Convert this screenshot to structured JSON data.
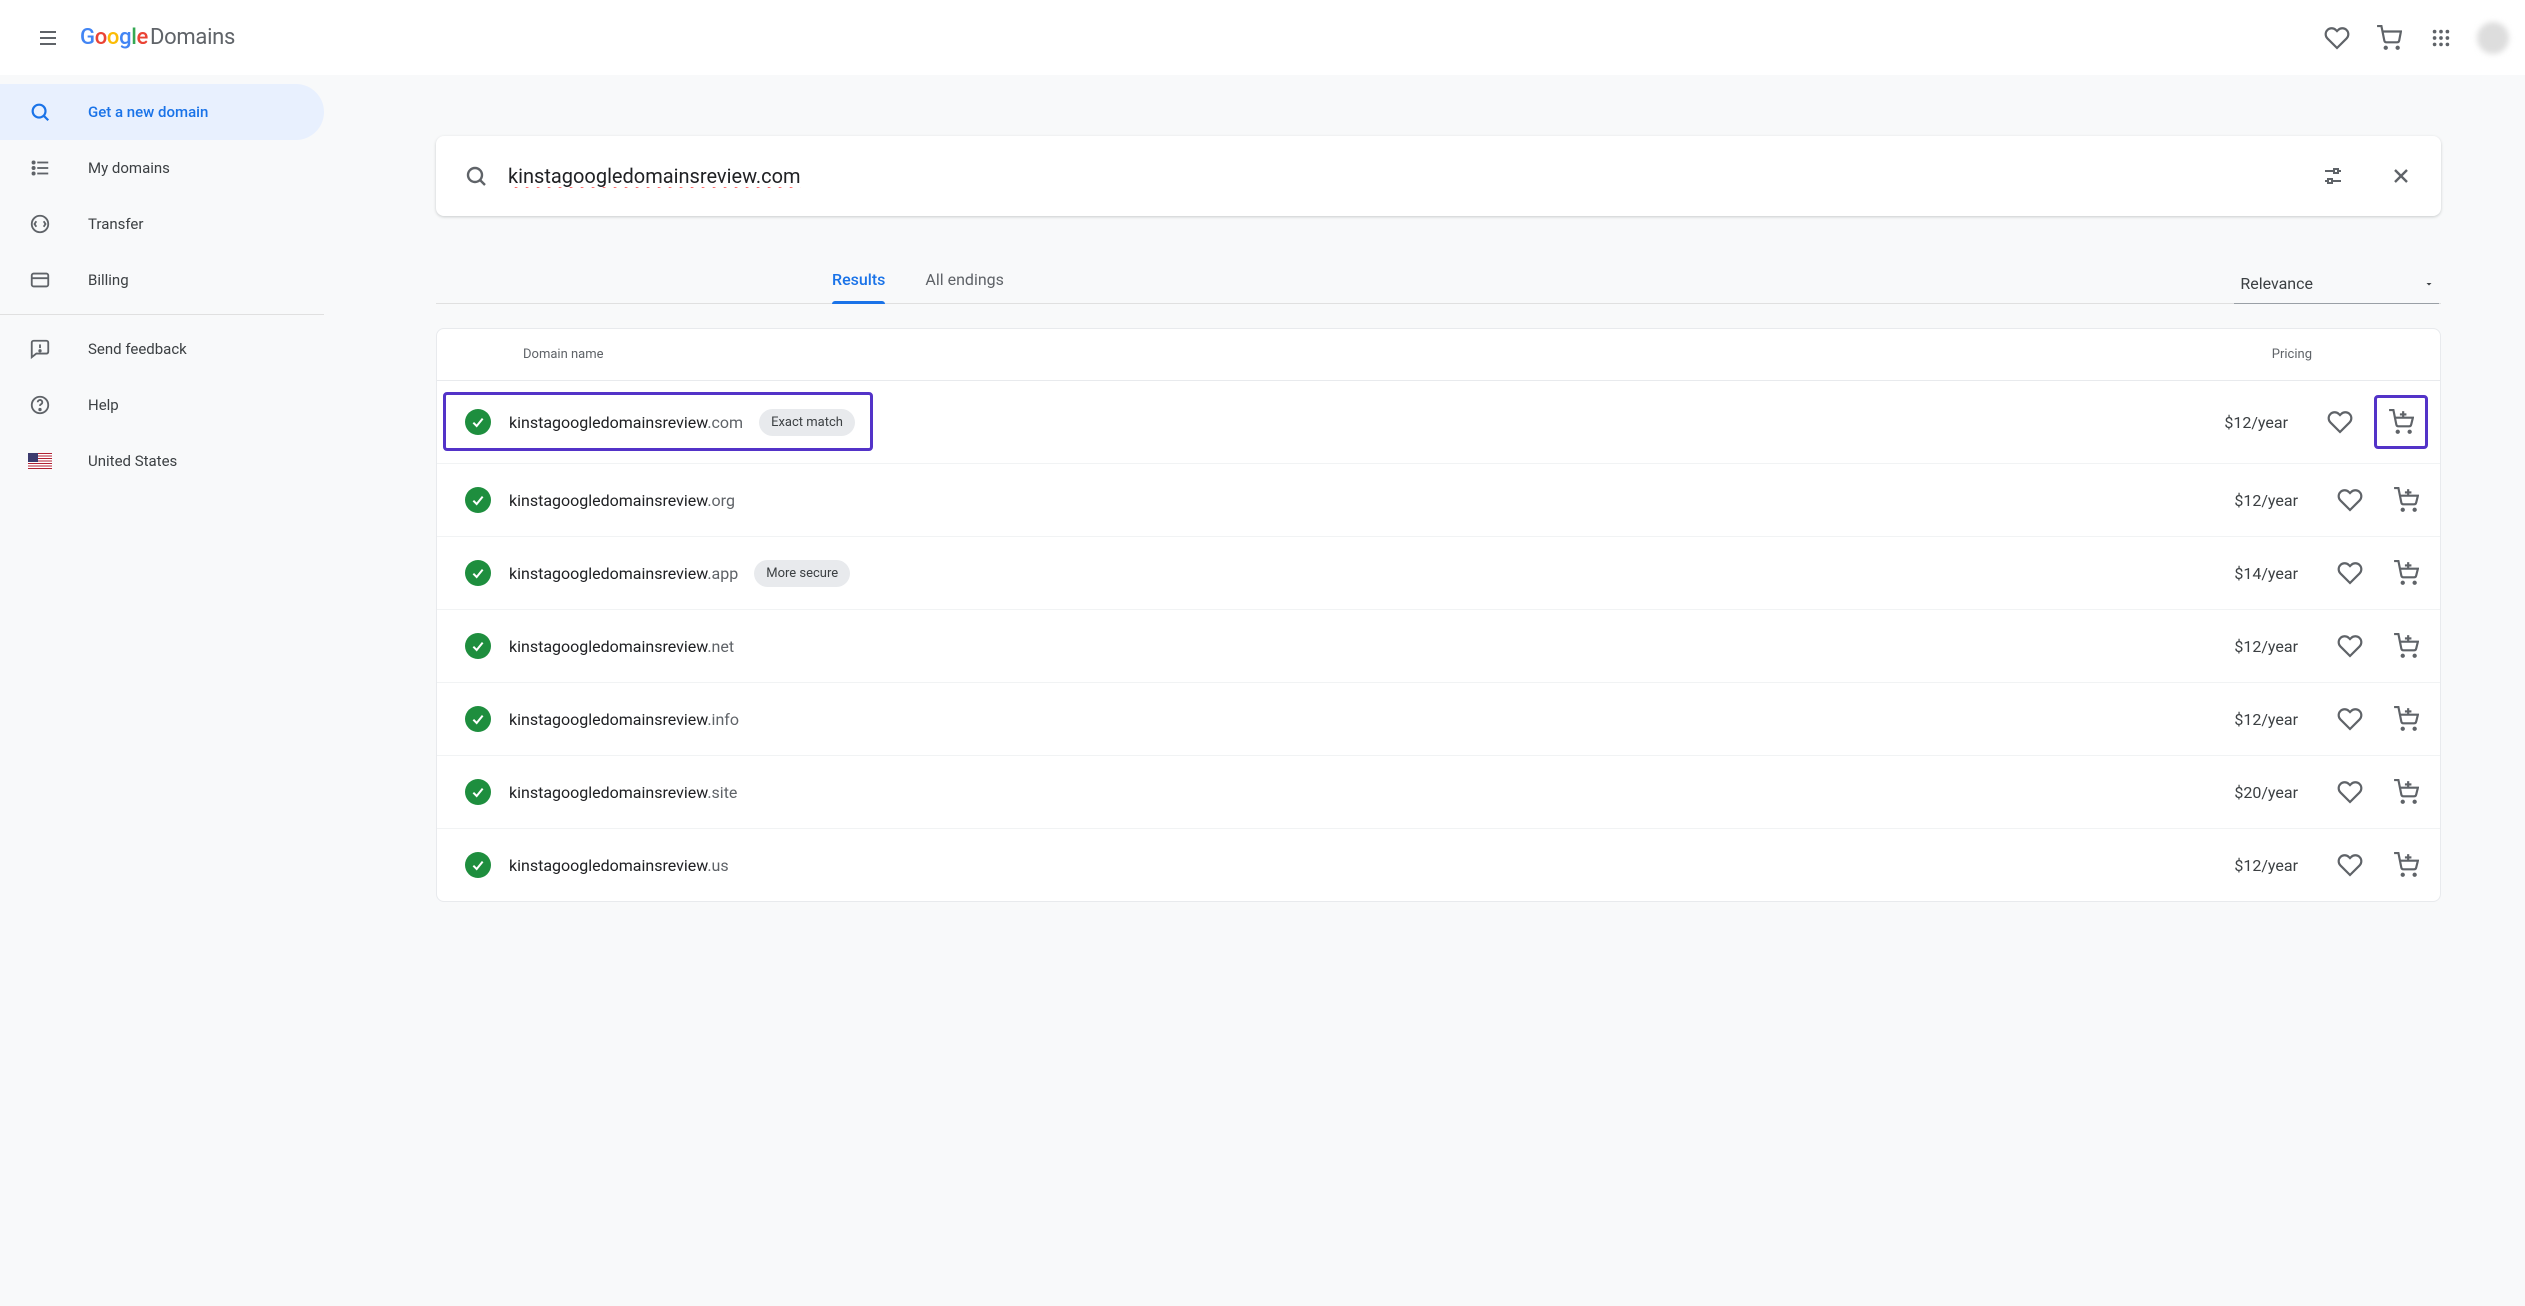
{
  "brand": {
    "product": "Domains"
  },
  "header_icons": {
    "favorites_alt": "Favorites",
    "cart_alt": "Cart",
    "apps_alt": "Google apps"
  },
  "sidebar": {
    "items": [
      {
        "id": "get-new",
        "label": "Get a new domain"
      },
      {
        "id": "my",
        "label": "My domains"
      },
      {
        "id": "transfer",
        "label": "Transfer"
      },
      {
        "id": "billing",
        "label": "Billing"
      }
    ],
    "footer_items": [
      {
        "id": "feedback",
        "label": "Send feedback"
      },
      {
        "id": "help",
        "label": "Help"
      },
      {
        "id": "region",
        "label": "United States"
      }
    ]
  },
  "search": {
    "value": "kinstagoogledomainsreview.com"
  },
  "tabs": {
    "results": "Results",
    "endings": "All endings"
  },
  "sort": {
    "label": "Relevance"
  },
  "columns": {
    "domain": "Domain name",
    "pricing": "Pricing"
  },
  "chips": {
    "exact_match": "Exact match",
    "more_secure": "More secure"
  },
  "results": [
    {
      "name": "kinstagoogledomainsreview",
      "tld": ".com",
      "price": "$12/year",
      "chip": "exact_match",
      "highlight": true
    },
    {
      "name": "kinstagoogledomainsreview",
      "tld": ".org",
      "price": "$12/year"
    },
    {
      "name": "kinstagoogledomainsreview",
      "tld": ".app",
      "price": "$14/year",
      "chip": "more_secure"
    },
    {
      "name": "kinstagoogledomainsreview",
      "tld": ".net",
      "price": "$12/year"
    },
    {
      "name": "kinstagoogledomainsreview",
      "tld": ".info",
      "price": "$12/year"
    },
    {
      "name": "kinstagoogledomainsreview",
      "tld": ".site",
      "price": "$20/year"
    },
    {
      "name": "kinstagoogledomainsreview",
      "tld": ".us",
      "price": "$12/year"
    }
  ]
}
